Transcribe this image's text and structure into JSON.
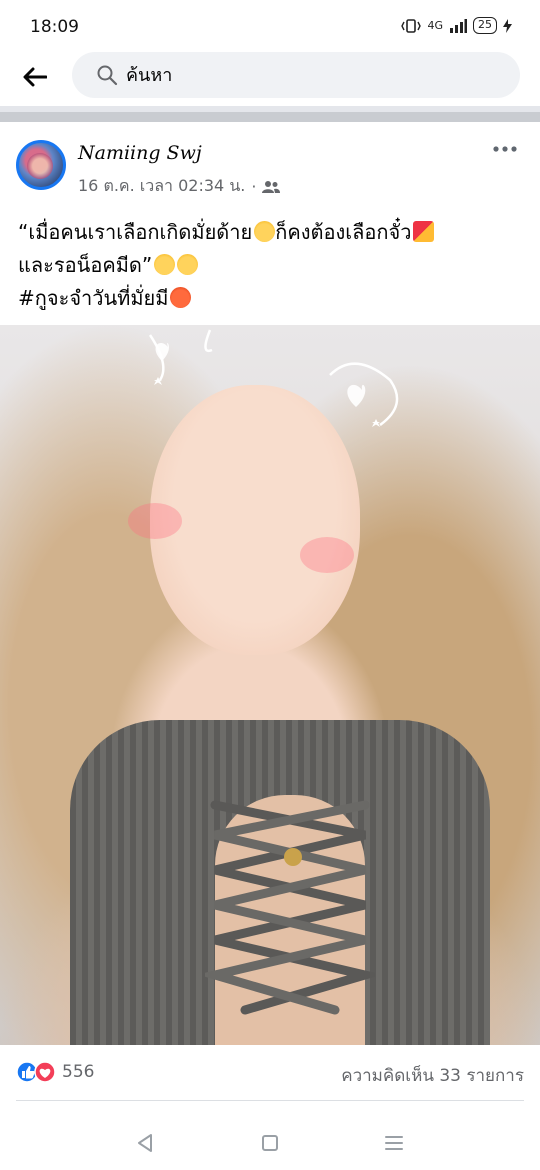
{
  "status_bar": {
    "time": "18:09",
    "network": "4G",
    "battery": "25"
  },
  "search": {
    "placeholder": "ค้นหา"
  },
  "post": {
    "author": "Namiing Swj",
    "date": "16 ต.ค. เวลา 02:34 น.",
    "separator": "·",
    "audience_icon": "friends-icon",
    "text_lines": [
      "“เมื่อคนเราเลือกเกิดมั่ยด้าย",
      "ก็คงต้องเลือกจั๋ว",
      "และรอน็อคมีด”",
      "#กูจะจำวันที่มั่ยมี"
    ],
    "reactions": {
      "types": [
        "like",
        "love"
      ],
      "count": "556"
    },
    "comments_label": "ความคิดเห็น 33 รายการ"
  },
  "colors": {
    "accent": "#1877f2",
    "love": "#f33e58",
    "secondary_text": "#65676b",
    "search_bg": "#f0f2f5"
  },
  "nav_icons": [
    "back-triangle-icon",
    "home-square-icon",
    "menu-lines-icon"
  ]
}
